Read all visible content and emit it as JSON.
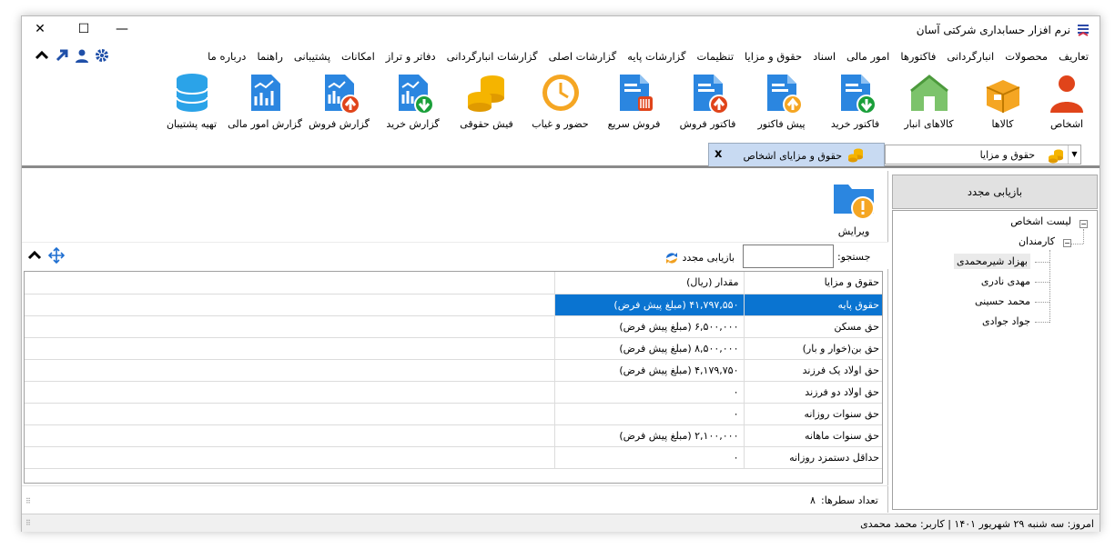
{
  "window": {
    "title": "نرم افزار حسابداری شرکتی آسان",
    "close_glyph": "✕",
    "maximize_glyph": "☐",
    "minimize_glyph": "—"
  },
  "menu": [
    "تعاریف",
    "محصولات",
    "انبارگردانی",
    "فاکتورها",
    "امور مالی",
    "اسناد",
    "حقوق و مزایا",
    "تنظیمات",
    "گزارشات پایه",
    "گزارشات اصلی",
    "گزارشات انبارگردانی",
    "دفاتر و تراز",
    "امکانات",
    "پشتیبانی",
    "راهنما",
    "درباره ما"
  ],
  "toolbar": [
    {
      "label": "اشخاص",
      "icon": "person-icon"
    },
    {
      "label": "کالاها",
      "icon": "box-icon"
    },
    {
      "label": "کالاهای انبار",
      "icon": "warehouse-icon"
    },
    {
      "label": "فاکتور خرید",
      "icon": "purchase-invoice-icon"
    },
    {
      "label": "پیش فاکتور",
      "icon": "proforma-icon"
    },
    {
      "label": "فاکتور فروش",
      "icon": "sales-invoice-icon"
    },
    {
      "label": "فروش سریع",
      "icon": "quick-sale-icon"
    },
    {
      "label": "حضور و غیاب",
      "icon": "clock-icon"
    },
    {
      "label": "فیش حقوقی",
      "icon": "coins-icon"
    },
    {
      "label": "گزارش خرید",
      "icon": "purchase-report-icon"
    },
    {
      "label": "گزارش فروش",
      "icon": "sales-report-icon"
    },
    {
      "label": "گزارش امور مالی",
      "icon": "finance-report-icon"
    },
    {
      "label": "تهیه پشتیبان",
      "icon": "database-icon"
    }
  ],
  "module_dropdown": {
    "label": "حقوق و مزایا"
  },
  "tab": {
    "label": "حقوق و مزایای اشخاص",
    "close": "x"
  },
  "edit_button": {
    "label": "ویرایش"
  },
  "search": {
    "label": "جستجو:",
    "value": ""
  },
  "refresh_link": {
    "label": "بازیابی مجدد"
  },
  "grid": {
    "headers": [
      "حقوق و مزایا",
      "مقدار (ریال)"
    ],
    "rows": [
      [
        "حقوق پایه",
        "۴۱,۷۹۷,۵۵۰ (مبلغ پیش فرض)"
      ],
      [
        "حق مسکن",
        "۶,۵۰۰,۰۰۰ (مبلغ پیش فرض)"
      ],
      [
        "حق بن(خوار و بار)",
        "۸,۵۰۰,۰۰۰ (مبلغ پیش فرض)"
      ],
      [
        "حق اولاد یک فرزند",
        "۴,۱۷۹,۷۵۰ (مبلغ پیش فرض)"
      ],
      [
        "حق اولاد دو فرزند",
        "۰"
      ],
      [
        "حق سنوات روزانه",
        "۰"
      ],
      [
        "حق سنوات ماهانه",
        "۲,۱۰۰,۰۰۰ (مبلغ پیش فرض)"
      ],
      [
        "حداقل دستمزد روزانه",
        "۰"
      ]
    ]
  },
  "row_count": {
    "label": "تعداد سطرها:",
    "value": "۸"
  },
  "sidebar": {
    "refresh_button": "بازیابی مجدد",
    "tree": {
      "root": "لیست اشخاص",
      "group": "کارمندان",
      "people": [
        "بهزاد شیرمحمدی",
        "مهدی نادری",
        "محمد حسینی",
        "جواد جوادی"
      ]
    }
  },
  "status": {
    "text": "امروز: سه شنبه ۲۹ شهریور ۱۴۰۱   |   کاربر: محمد محمدی"
  },
  "colors": {
    "accent": "#0a74d1",
    "folder": "#2b86e0",
    "warn": "#f5a623"
  }
}
